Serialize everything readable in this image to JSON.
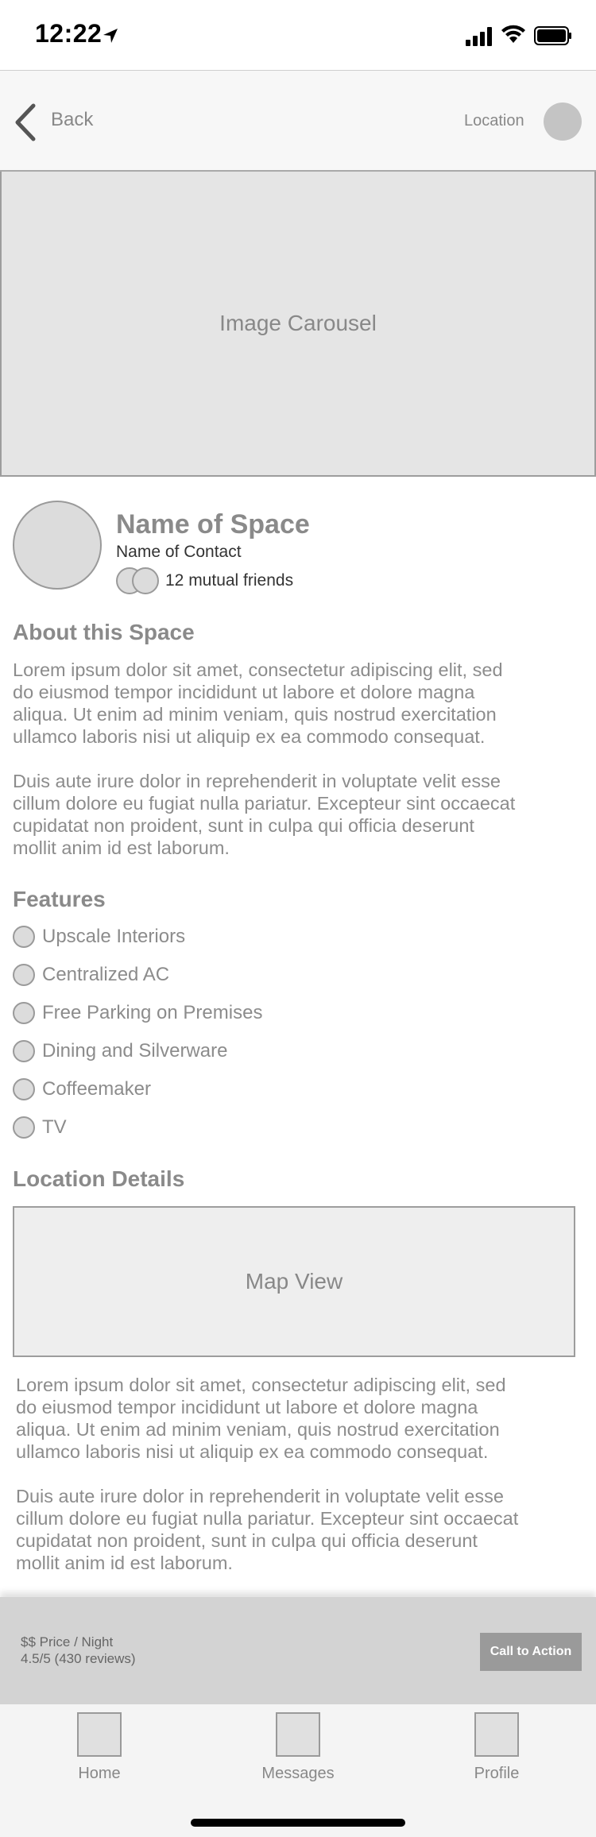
{
  "status_bar": {
    "time": "12:22"
  },
  "nav": {
    "back_label": "Back",
    "location_label": "Location"
  },
  "carousel": {
    "label": "Image Carousel"
  },
  "space": {
    "name": "Name of Space",
    "contact": "Name of Contact",
    "mutual_friends": "12 mutual friends"
  },
  "about": {
    "title": "About this Space",
    "paragraphs": [
      [
        "Lorem ipsum dolor sit amet, consectetur adipiscing elit, sed",
        "do eiusmod tempor incididunt ut labore et dolore magna",
        "aliqua. Ut enim ad minim veniam, quis nostrud exercitation",
        "ullamco laboris nisi ut aliquip ex ea commodo consequat."
      ],
      [
        "Duis aute irure dolor in reprehenderit in voluptate velit esse",
        "cillum dolore eu fugiat nulla pariatur. Excepteur sint occaecat",
        "cupidatat non proident, sunt in culpa qui officia deserunt",
        "mollit anim id est laborum."
      ]
    ]
  },
  "features": {
    "title": "Features",
    "items": [
      "Upscale Interiors",
      "Centralized AC",
      "Free Parking on Premises",
      "Dining and Silverware",
      "Coffeemaker",
      "TV"
    ]
  },
  "location": {
    "title": "Location Details",
    "map_label": "Map View",
    "paragraphs": [
      [
        "Lorem ipsum dolor sit amet, consectetur adipiscing elit, sed",
        "do eiusmod tempor incididunt ut labore et dolore magna",
        "aliqua. Ut enim ad minim veniam, quis nostrud exercitation",
        "ullamco laboris nisi ut aliquip ex ea commodo consequat."
      ],
      [
        "Duis aute irure dolor in reprehenderit in voluptate velit esse",
        "cillum dolore eu fugiat nulla pariatur. Excepteur sint occaecat",
        "cupidatat non proident, sunt in culpa qui officia deserunt",
        "mollit anim id est laborum."
      ]
    ]
  },
  "booking": {
    "price": "$$ Price / Night",
    "rating": "4.5/5 (430 reviews)",
    "cta_label": "Call to Action"
  },
  "tabs": [
    {
      "label": "Home",
      "icon": "home-icon"
    },
    {
      "label": "Messages",
      "icon": "messages-icon"
    },
    {
      "label": "Profile",
      "icon": "profile-icon"
    }
  ]
}
